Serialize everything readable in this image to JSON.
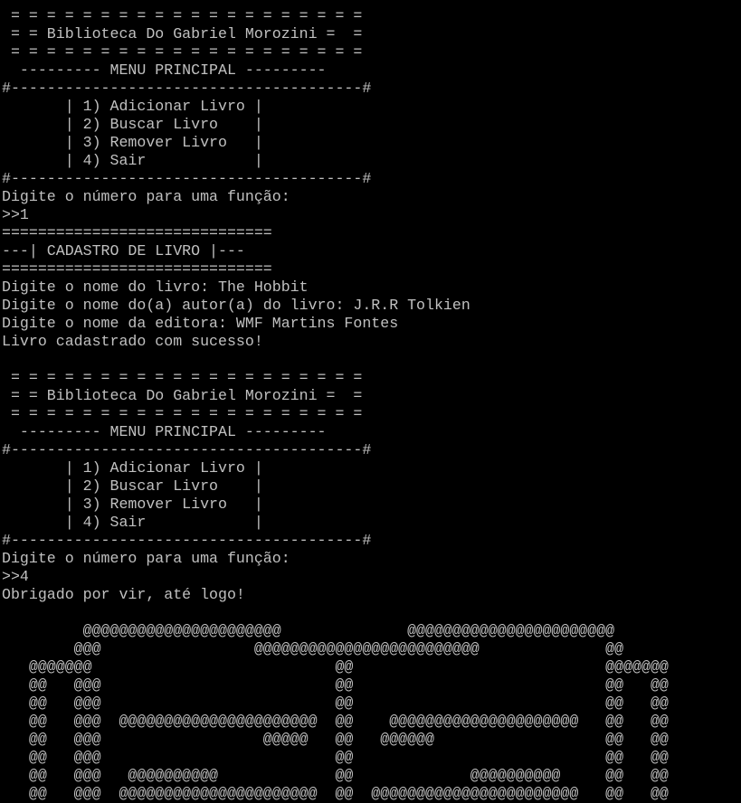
{
  "terminal": {
    "text_color": "#c0c0c0",
    "background_color": "#000000",
    "lines": [
      " = = = = = = = = = = = = = = = = = = = =",
      " = = = = = = = = = = = = = = = = = = = =",
      " = = Biblioteca Do Gabriel Morozini =  =",
      " = = = = = = = = = = = = = = = = = = = =",
      "  --------- MENU PRINCIPAL ---------",
      "#---------------------------------------#",
      "       | 1) Adicionar Livro |",
      "       | 2) Buscar Livro    |",
      "       | 3) Remover Livro   |",
      "       | 4) Sair            |",
      "#---------------------------------------#",
      "Digite o número para uma função:",
      ">>1",
      "==============================",
      "---| CADASTRO DE LIVRO |---",
      "==============================",
      "Digite o nome do livro: The Hobbit",
      "Digite o nome do(a) autor(a) do livro: J.R.R Tolkien",
      "Digite o nome da editora: WMF Martins Fontes",
      "Livro cadastrado com sucesso!",
      "",
      " = = = = = = = = = = = = = = = = = = = =",
      " = = Biblioteca Do Gabriel Morozini =  =",
      " = = = = = = = = = = = = = = = = = = = =",
      "  --------- MENU PRINCIPAL ---------",
      "#---------------------------------------#",
      "       | 1) Adicionar Livro |",
      "       | 2) Buscar Livro    |",
      "       | 3) Remover Livro   |",
      "       | 4) Sair            |",
      "#---------------------------------------#",
      "Digite o número para uma função:",
      ">>4",
      "Obrigado por vir, até logo!",
      "",
      "         @@@@@@@@@@@@@@@@@@@@@@              @@@@@@@@@@@@@@@@@@@@@@@",
      "        @@@                 @@@@@@@@@@@@@@@@@@@@@@@@@              @@",
      "   @@@@@@@                           @@                            @@@@@@@",
      "   @@   @@@                          @@                            @@   @@",
      "   @@   @@@                          @@                            @@   @@",
      "   @@   @@@  @@@@@@@@@@@@@@@@@@@@@@  @@    @@@@@@@@@@@@@@@@@@@@@   @@   @@",
      "   @@   @@@                  @@@@@   @@   @@@@@@                   @@   @@",
      "   @@   @@@                          @@                            @@   @@",
      "   @@   @@@   @@@@@@@@@@             @@             @@@@@@@@@@     @@   @@",
      "   @@   @@@  @@@@@@@@@@@@@@@@@@@@@@  @@  @@@@@@@@@@@@@@@@@@@@@@@   @@   @@"
    ]
  }
}
